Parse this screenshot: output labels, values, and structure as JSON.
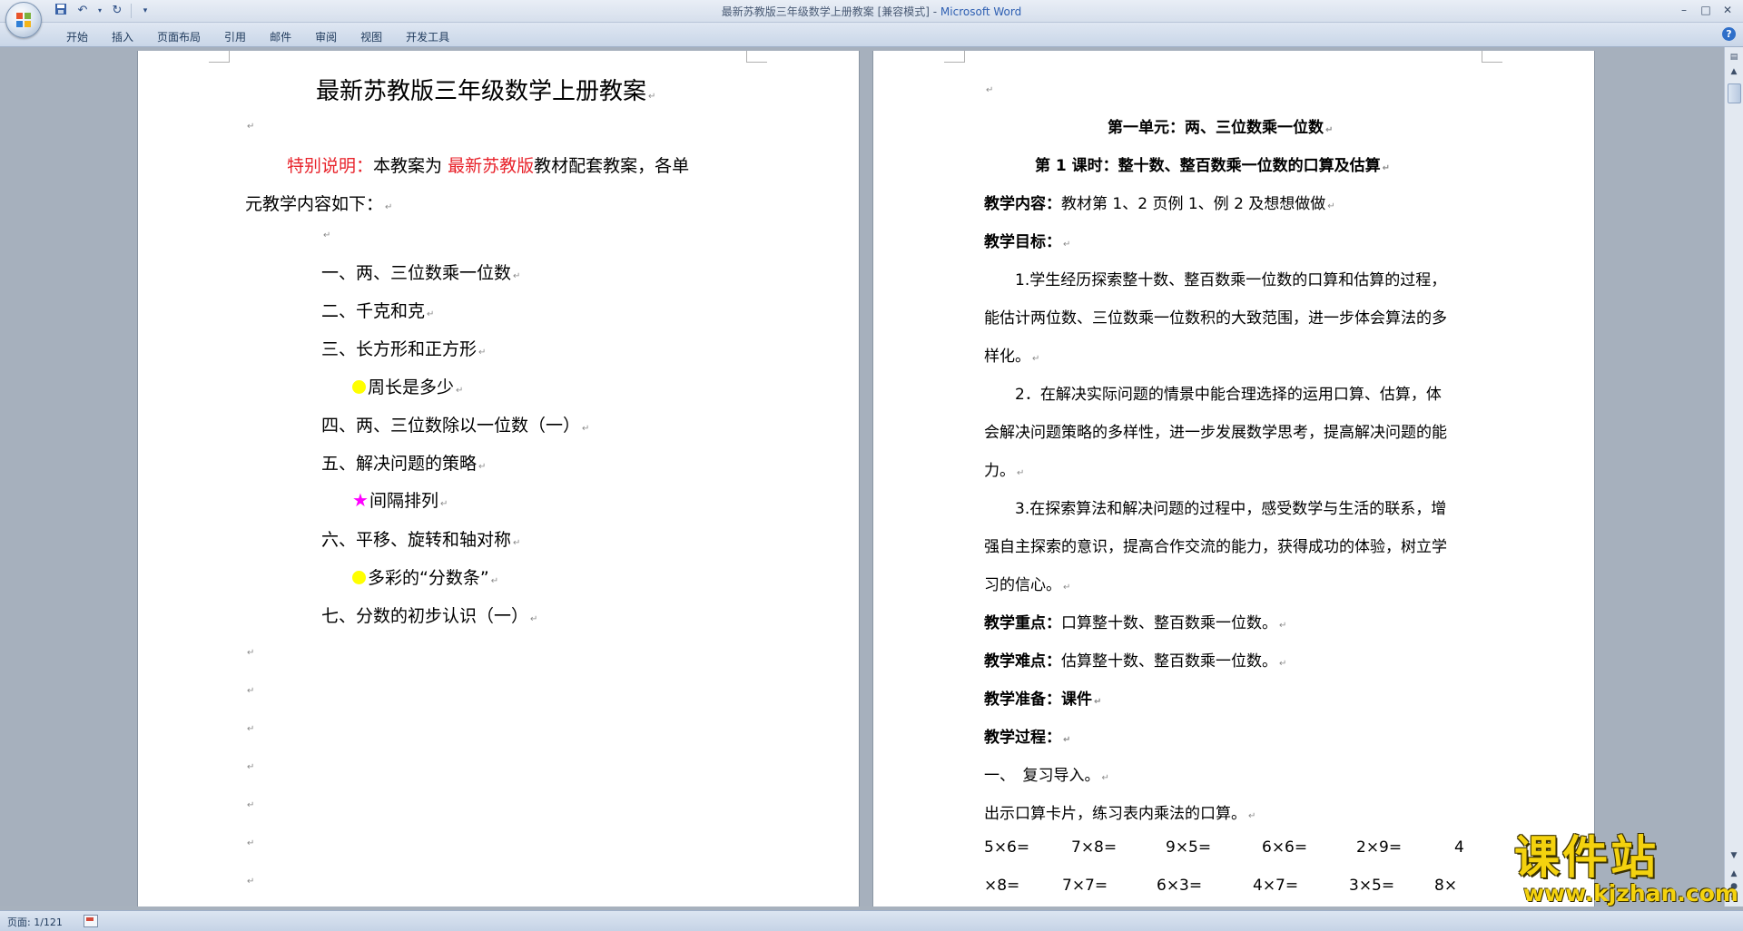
{
  "window": {
    "title_doc": "最新苏教版三年级数学上册教案 [兼容模式] - ",
    "title_app": "Microsoft Word"
  },
  "quick_access": {
    "save_icon": "save-icon",
    "undo_icon": "undo-icon",
    "redo_icon": "redo-icon",
    "customize_icon": "customize-icon"
  },
  "ribbon": {
    "tabs": [
      "开始",
      "插入",
      "页面布局",
      "引用",
      "邮件",
      "审阅",
      "视图",
      "开发工具"
    ],
    "help_label": "?"
  },
  "page1": {
    "title": "最新苏教版三年级数学上册教案",
    "note_label": "特别说明：",
    "note_text1": "本教案为 ",
    "note_highlight": "最新苏教版",
    "note_text2": "教材配套教案，各单",
    "note_line2": "元教学内容如下：",
    "units": [
      "一、两、三位数乘一位数",
      "二、千克和克",
      "三、长方形和正方形",
      "周长是多少",
      "四、两、三位数除以一位数（一）",
      "五、解决问题的策略",
      "间隔排列",
      "六、平移、旋转和轴对称",
      "多彩的“分数条”",
      "七、分数的初步认识（一）"
    ]
  },
  "page2": {
    "unit_title": "第一单元：两、三位数乘一位数",
    "lesson_title": "第 1 课时：整十数、整百数乘一位数的口算及估算",
    "content_label": "教学内容：",
    "content_text": "教材第 1、2 页例 1、例 2 及想想做做",
    "goal_label": "教学目标：",
    "goal1_l1": "1.学生经历探索整十数、整百数乘一位数的口算和估算的过程，",
    "goal1_l2": "能估计两位数、三位数乘一位数积的大致范围，进一步体会算法的多",
    "goal1_l3": "样化。",
    "goal2_l1": "2．在解决实际问题的情景中能合理选择的运用口算、估算，体",
    "goal2_l2": "会解决问题策略的多样性，进一步发展数学思考，提高解决问题的能",
    "goal2_l3": "力。",
    "goal3_l1": "3.在探索算法和解决问题的过程中，感受数学与生活的联系，增",
    "goal3_l2": "强自主探索的意识，提高合作交流的能力，获得成功的体验，树立学",
    "goal3_l3": "习的信心。",
    "key_label": "教学重点：",
    "key_text": "口算整十数、整百数乘一位数。",
    "diff_label": "教学难点：",
    "diff_text": "估算整十数、整百数乘一位数。",
    "prep_label": "教学准备：课件",
    "process_label": "教学过程：",
    "step1": "一、　复习导入。",
    "step1_text": "出示口算卡片，练习表内乘法的口算。",
    "drill_row1": [
      "5×6=",
      "7×8=",
      "9×5=",
      "6×6=",
      "2×9=",
      "4"
    ],
    "drill_row2": [
      "×8=",
      "7×7=",
      "6×3=",
      "4×7=",
      "3×5=",
      "8×"
    ]
  },
  "statusbar": {
    "page_info": "页面: 1/121"
  },
  "watermark": {
    "big": "课件站",
    "url": "www.kjzhan.com"
  },
  "colors": {
    "accent_red": "#e8232b",
    "bullet_yellow": "#ffff00",
    "star_magenta": "#ff00ff",
    "watermark_yellow": "#f4d20e"
  }
}
